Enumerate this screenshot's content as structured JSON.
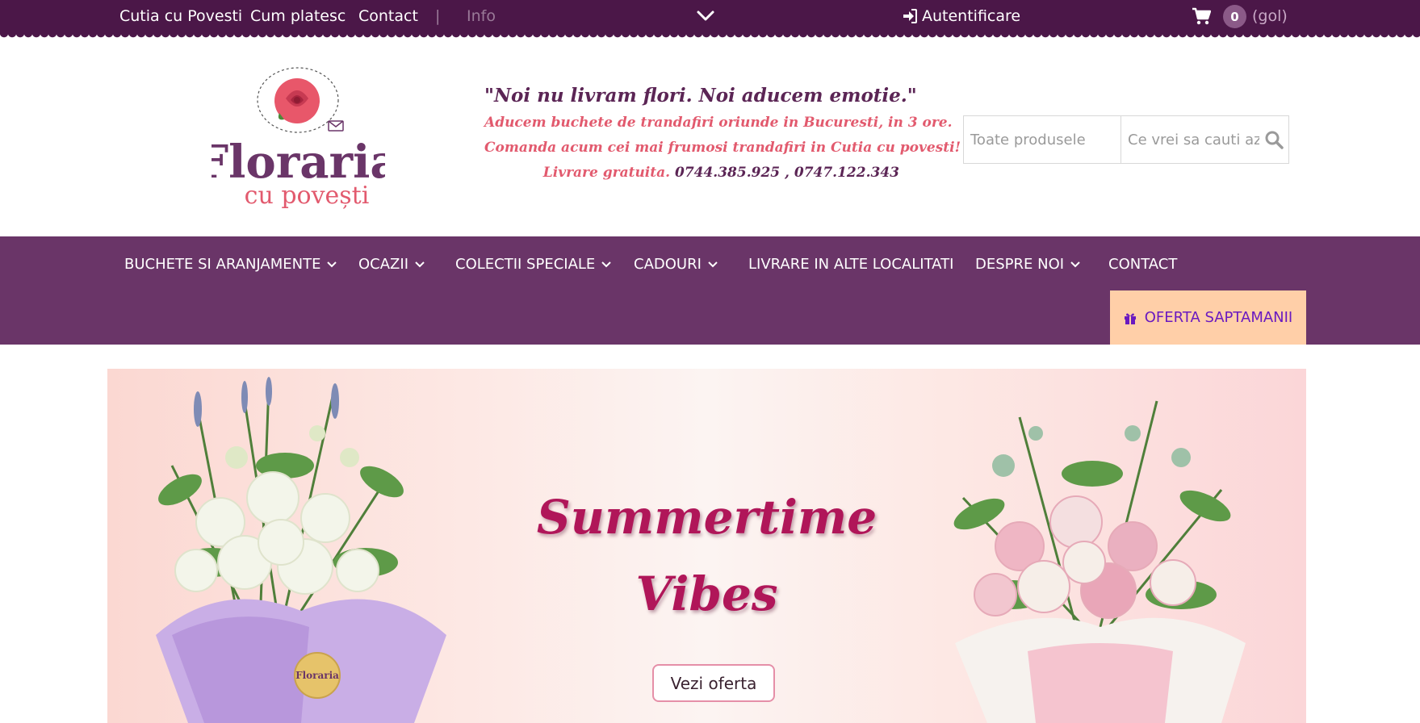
{
  "topbar": {
    "links": [
      "Cutia cu Povesti",
      "Cum platesc",
      "Contact"
    ],
    "separator": "|",
    "info": "Info",
    "login": "Autentificare",
    "cart_count": "0",
    "cart_empty": "(gol)"
  },
  "logo": {
    "name": "Floraria",
    "tagline": "cu povești"
  },
  "slogan": {
    "main": "\"Noi nu livram flori. Noi aducem emotie.\"",
    "line1": "Aducem buchete de trandafiri oriunde in Bucuresti, in 3 ore.",
    "line2": "Comanda acum cei mai frumosi trandafiri in Cutia cu povesti!",
    "line3_prefix": "Livrare gratuita.",
    "phones": "0744.385.925 , 0747.122.343"
  },
  "search": {
    "category": "Toate produsele",
    "placeholder": "Ce vrei sa cauti azi?"
  },
  "nav": {
    "items": [
      "BUCHETE SI ARANJAMENTE",
      "OCAZII",
      "COLECTII SPECIALE",
      "CADOURI",
      "LIVRARE IN ALTE LOCALITATI",
      "DESPRE NOI",
      "CONTACT"
    ],
    "offer": "OFERTA SAPTAMANII"
  },
  "banner": {
    "title_line1": "Summertime",
    "title_line2": "Vibes",
    "button": "Vezi oferta",
    "box_label": "Floraria"
  },
  "colors": {
    "topbar": "#4b1748",
    "nav": "#6a3568",
    "offer": "#ffcfa8",
    "accent": "#b01659"
  }
}
